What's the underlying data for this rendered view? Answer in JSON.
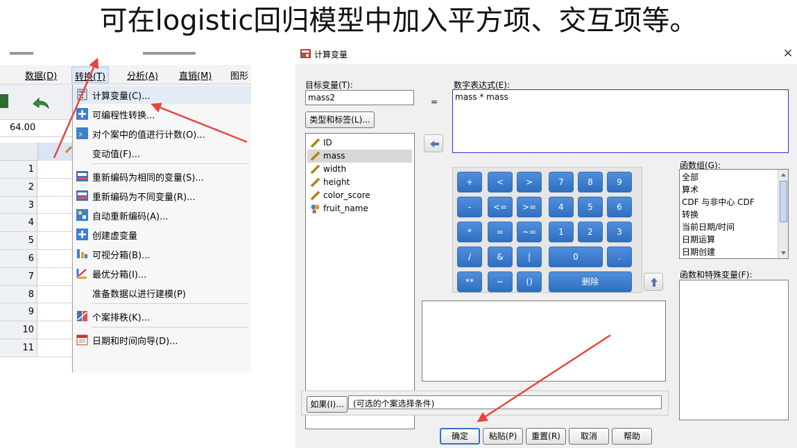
{
  "slide": {
    "title": "可在logistic回归模型中加入平方项、交互项等。"
  },
  "left_window": {
    "menubar": [
      {
        "label": "数据(D)"
      },
      {
        "label": "转换(T)",
        "active": true
      },
      {
        "label": "分析(A)"
      },
      {
        "label": "直销(M)"
      },
      {
        "label": "图形"
      }
    ],
    "cell_value": "64.00",
    "row_numbers": [
      "1",
      "2",
      "3",
      "4",
      "5",
      "6",
      "7",
      "8",
      "9",
      "10",
      "11"
    ],
    "menu_items": [
      {
        "label": "计算变量(C)...",
        "icon": "calculator-icon"
      },
      {
        "label": "可编程性转换...",
        "icon": "plus-icon"
      },
      {
        "label": "对个案中的值进行计数(O)...",
        "icon": "count-icon"
      },
      {
        "label": "变动值(F)...",
        "icon": ""
      },
      {
        "label": "重新编码为相同的变量(S)...",
        "icon": "recode-icon"
      },
      {
        "label": "重新编码为不同变量(R)...",
        "icon": "recode-icon"
      },
      {
        "label": "自动重新编码(A)...",
        "icon": "auto-recode-icon"
      },
      {
        "label": "创建虚变量",
        "icon": "plus-icon"
      },
      {
        "label": "可视分箱(B)...",
        "icon": "binning-icon"
      },
      {
        "label": "最优分箱(I)...",
        "icon": "optimal-binning-icon"
      },
      {
        "label": "准备数据以进行建模(P)",
        "icon": ""
      },
      {
        "label": "个案排秩(K)...",
        "icon": "rank-icon"
      },
      {
        "label": "日期和时间向导(D)...",
        "icon": "calendar-icon"
      }
    ]
  },
  "dialog": {
    "title": "计算变量",
    "target_label": "目标变量(T):",
    "target_value": "mass2",
    "equals": "=",
    "expression_label": "数字表达式(E):",
    "expression_value": "mass * mass",
    "type_label_button": "类型和标签(L)...",
    "variables": [
      {
        "name": "ID",
        "type": "scale",
        "selected": false
      },
      {
        "name": "mass",
        "type": "scale",
        "selected": true
      },
      {
        "name": "width",
        "type": "scale",
        "selected": false
      },
      {
        "name": "height",
        "type": "scale",
        "selected": false
      },
      {
        "name": "color_score",
        "type": "scale",
        "selected": false
      },
      {
        "name": "fruit_name",
        "type": "nominal",
        "selected": false
      }
    ],
    "keypad": [
      [
        "+",
        "<",
        ">",
        "7",
        "8",
        "9"
      ],
      [
        "-",
        "<=",
        ">=",
        "4",
        "5",
        "6"
      ],
      [
        "*",
        "=",
        "~=",
        "1",
        "2",
        "3"
      ],
      [
        "/",
        "&",
        "|",
        "0",
        "."
      ],
      [
        "**",
        "~",
        "()",
        "删除"
      ]
    ],
    "function_group_label": "函数组(G):",
    "function_groups": [
      "全部",
      "算术",
      "CDF 与非中心 CDF",
      "转换",
      "当前日期/时间",
      "日期运算",
      "日期创建"
    ],
    "functions_label": "函数和特殊变量(F):",
    "if_button": "如果(I)...",
    "if_hint": "(可选的个案选择条件)",
    "buttons": [
      "确定",
      "粘贴(P)",
      "重置(R)",
      "取消",
      "帮助"
    ],
    "colors": {
      "keypad_blue": "#3f7fd0",
      "ok_border": "#3370c8",
      "arrow_red": "#e8453c"
    }
  }
}
